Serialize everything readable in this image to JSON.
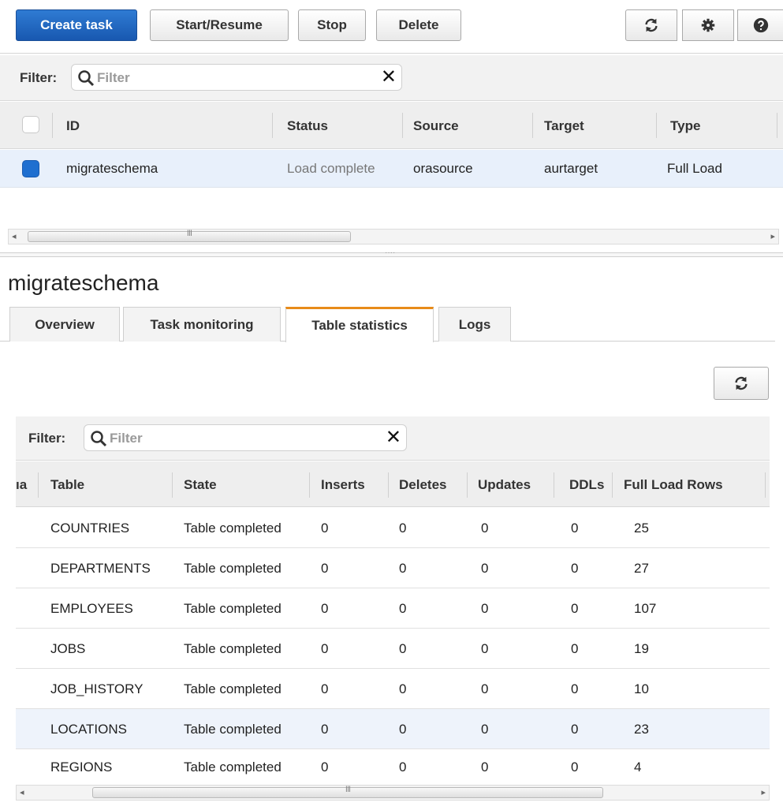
{
  "toolbar": {
    "create": "Create task",
    "start": "Start/Resume",
    "stop": "Stop",
    "delete": "Delete"
  },
  "filter": {
    "label": "Filter:",
    "placeholder": "Filter",
    "clear": "✕"
  },
  "tasks": {
    "columns": [
      "ID",
      "Status",
      "Source",
      "Target",
      "Type"
    ],
    "rows": [
      {
        "id": "migrateschema",
        "status": "Load complete",
        "source": "orasource",
        "target": "aurtarget",
        "type": "Full Load"
      }
    ]
  },
  "detail": {
    "title": "migrateschema",
    "tabs": [
      "Overview",
      "Task monitoring",
      "Table statistics",
      "Logs"
    ],
    "active_tab": "Table statistics"
  },
  "stats": {
    "filter_label": "Filter:",
    "placeholder": "Filter",
    "clear": "✕",
    "columns": [
      "ıa",
      "Table",
      "State",
      "Inserts",
      "Deletes",
      "Updates",
      "DDLs",
      "Full Load Rows"
    ],
    "rows": [
      {
        "table": "COUNTRIES",
        "state": "Table completed",
        "inserts": "0",
        "deletes": "0",
        "updates": "0",
        "ddls": "0",
        "full_load_rows": "25"
      },
      {
        "table": "DEPARTMENTS",
        "state": "Table completed",
        "inserts": "0",
        "deletes": "0",
        "updates": "0",
        "ddls": "0",
        "full_load_rows": "27"
      },
      {
        "table": "EMPLOYEES",
        "state": "Table completed",
        "inserts": "0",
        "deletes": "0",
        "updates": "0",
        "ddls": "0",
        "full_load_rows": "107"
      },
      {
        "table": "JOBS",
        "state": "Table completed",
        "inserts": "0",
        "deletes": "0",
        "updates": "0",
        "ddls": "0",
        "full_load_rows": "19"
      },
      {
        "table": "JOB_HISTORY",
        "state": "Table completed",
        "inserts": "0",
        "deletes": "0",
        "updates": "0",
        "ddls": "0",
        "full_load_rows": "10"
      },
      {
        "table": "LOCATIONS",
        "state": "Table completed",
        "inserts": "0",
        "deletes": "0",
        "updates": "0",
        "ddls": "0",
        "full_load_rows": "23"
      },
      {
        "table": "REGIONS",
        "state": "Table completed",
        "inserts": "0",
        "deletes": "0",
        "updates": "0",
        "ddls": "0",
        "full_load_rows": "4"
      }
    ]
  },
  "scroll_grip": "III",
  "colors": {
    "primary": "#1f63c0",
    "active_tab": "#e88b1a",
    "selected_row": "#e8f0fb"
  }
}
